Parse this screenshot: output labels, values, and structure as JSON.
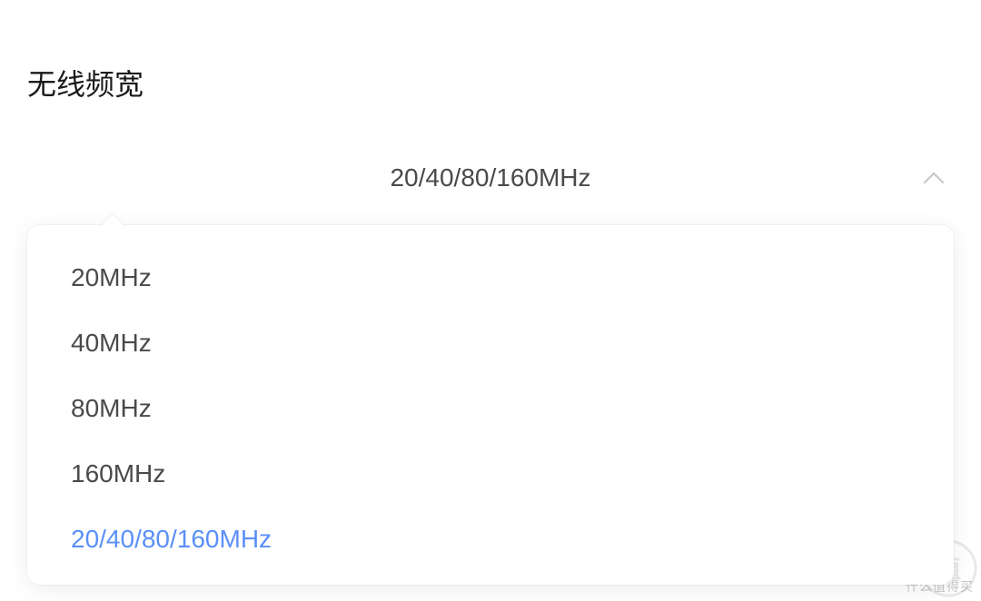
{
  "title": "无线频宽",
  "select": {
    "current": "20/40/80/160MHz"
  },
  "options": [
    {
      "label": "20MHz",
      "selected": false
    },
    {
      "label": "40MHz",
      "selected": false
    },
    {
      "label": "80MHz",
      "selected": false
    },
    {
      "label": "160MHz",
      "selected": false
    },
    {
      "label": "20/40/80/160MHz",
      "selected": true
    }
  ],
  "watermark": {
    "text": "什么值得买"
  },
  "colors": {
    "accent": "#5b8ff9",
    "text": "#4a4a4a",
    "title": "#1a1a1a"
  }
}
